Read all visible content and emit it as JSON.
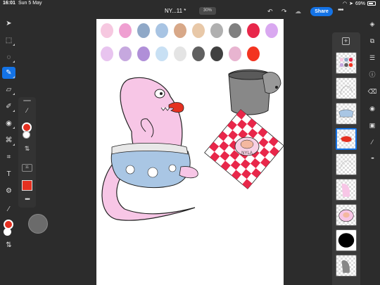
{
  "status": {
    "time": "16:01",
    "date": "Sun 5 May",
    "battery": "69%"
  },
  "header": {
    "doc_title": "NY...11 *",
    "zoom": "30%",
    "share_label": "Share"
  },
  "icons": {
    "undo": "undo-icon",
    "redo": "redo-icon",
    "cloud": "cloud-icon",
    "more": "more-icon"
  },
  "left_tools": [
    "select-tool",
    "transform-tool",
    "lasso-tool",
    "brush-tool",
    "eraser-tool",
    "smudge-tool",
    "fill-tool",
    "clone-tool",
    "crop-tool",
    "type-tool",
    "adjust-tool",
    "eyedropper-tool"
  ],
  "sub_panel": {
    "size_label": "11",
    "more": "•••"
  },
  "right_tools": [
    "layers-icon",
    "layer-properties-icon",
    "adjustments-icon",
    "info-icon",
    "brush-settings-icon",
    "visibility-icon",
    "mask-icon",
    "effects-icon",
    "more-icon"
  ],
  "palette_colors": [
    "#f6c8e0",
    "#ef9fd1",
    "#8fa8c7",
    "#a8c4e3",
    "#d8a888",
    "#e8c8a8",
    "#b0b0b0",
    "#808080",
    "#e8274a",
    "#d9a8f0",
    "#e8c4ef",
    "#c6a8df",
    "#b08fd8",
    "#c8e0f4",
    "#e4e4e4",
    "#606060",
    "#404040",
    "#e8b4d0",
    "#f33420"
  ],
  "colors": {
    "accent": "#1473e6",
    "foreground": "#e53020",
    "background": "#ffffff",
    "mushroom_pink": "#f7c6e6"
  },
  "layers": [
    {
      "name": "palette-layer",
      "selected": false
    },
    {
      "name": "sketch-layer",
      "selected": false
    },
    {
      "name": "shorts-layer",
      "selected": false
    },
    {
      "name": "tongue-layer",
      "selected": true
    },
    {
      "name": "outline-layer",
      "selected": false
    },
    {
      "name": "body-layer",
      "selected": false
    },
    {
      "name": "plate-layer",
      "selected": false
    },
    {
      "name": "black-fill-layer",
      "selected": false
    },
    {
      "name": "gray-layer",
      "selected": false
    }
  ],
  "artwork": {
    "plate_text": "NYLA"
  }
}
